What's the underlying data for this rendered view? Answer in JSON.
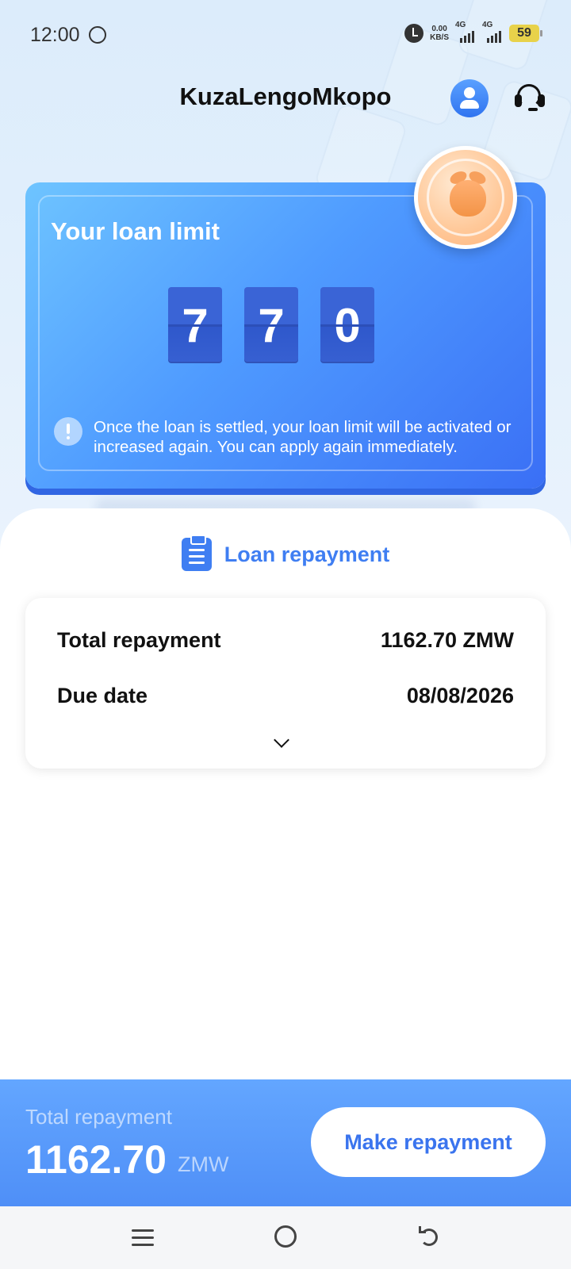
{
  "status_bar": {
    "time": "12:00",
    "speed_value": "0.00",
    "speed_unit": "KB/S",
    "network1": "4G",
    "network2": "4G",
    "battery": "59"
  },
  "header": {
    "title": "KuzaLengoMkopo"
  },
  "loan_card": {
    "title": "Your loan limit",
    "digits": [
      "7",
      "7",
      "0"
    ],
    "notice": "Once the loan is settled, your loan limit will be activated or increased again. You can apply again immediately."
  },
  "repayment": {
    "section_title": "Loan repayment",
    "rows": [
      {
        "label": "Total repayment",
        "value": "1162.70 ZMW"
      },
      {
        "label": "Due date",
        "value": "08/08/2026"
      }
    ]
  },
  "bottom_bar": {
    "label": "Total repayment",
    "amount": "1162.70",
    "currency": "ZMW",
    "button_label": "Make repayment"
  },
  "icons": {
    "whatsapp": "whatsapp-icon",
    "alarm": "alarm-icon",
    "profile": "profile-icon",
    "support": "headset-icon",
    "coin": "coin-bag-icon",
    "notice": "exclamation-icon",
    "clipboard": "clipboard-icon",
    "expand": "chevron-down-icon"
  },
  "colors": {
    "accent": "#3f7ef2",
    "card_gradient_start": "#6ec4ff",
    "card_gradient_end": "#3a6ff5",
    "battery": "#e8d24a"
  }
}
